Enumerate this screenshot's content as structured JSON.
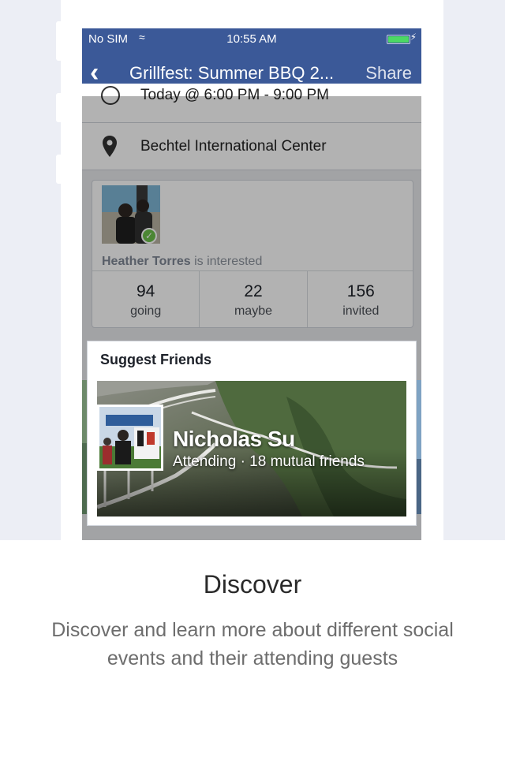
{
  "status_bar": {
    "carrier": "No SIM",
    "time": "10:55 AM"
  },
  "nav": {
    "title": "Grillfest: Summer BBQ 2...",
    "share": "Share"
  },
  "event": {
    "time": "Today @ 6:00 PM - 9:00 PM",
    "location": "Bechtel International Center"
  },
  "interest": {
    "name": "Heather Torres",
    "suffix": " is interested"
  },
  "stats": [
    {
      "count": "94",
      "label": "going"
    },
    {
      "count": "22",
      "label": "maybe"
    },
    {
      "count": "156",
      "label": "invited"
    }
  ],
  "suggest": {
    "title": "Suggest Friends",
    "friend_name": "Nicholas Su",
    "friend_meta": "Attending · 18 mutual friends"
  },
  "onboarding": {
    "heading": "Discover",
    "description": "Discover and learn more about different social events and their attending guests"
  },
  "colors": {
    "brand": "#3b5998",
    "background": "#eceef5",
    "battery": "#4cd964",
    "check": "#6cc04a"
  }
}
